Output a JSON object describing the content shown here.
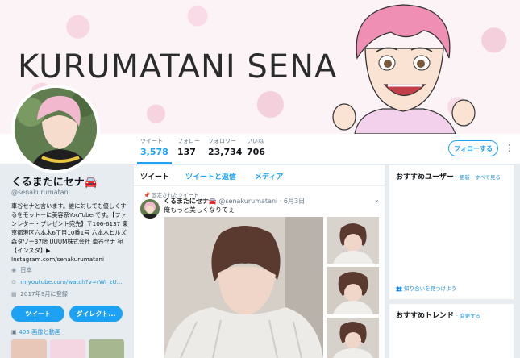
{
  "banner": {
    "title": "KURUMATANI SENA"
  },
  "nav": {
    "stats": [
      {
        "label": "ツイート",
        "value": "3,578"
      },
      {
        "label": "フォロー",
        "value": "137"
      },
      {
        "label": "フォロワー",
        "value": "23,734"
      },
      {
        "label": "いいね",
        "value": "706"
      }
    ],
    "follow_label": "フォローする",
    "more_glyph": "⋮"
  },
  "profile": {
    "name": "くるまたにセナ🚘",
    "handle": "@senakurumatani",
    "bio": "車谷セナと言います。誰に対しても優しくするをモットーに美容系YouTuberです。【ファンレター・プレゼント宛先】〒106-6137 東京都港区六本木6丁目10番1号 六本木ヒルズ森タワー37階 UUUM株式会社 車谷セナ 宛 【インスタ】▶ Instagram.com/senakurumatani",
    "location": "日本",
    "website": "m.youtube.com/watch?v=rWI_zU...",
    "joined": "2017年9月に登録",
    "tweet_button": "ツイート",
    "dm_button": "ダイレクト...",
    "media_link": "405 画像と動画"
  },
  "timeline": {
    "tabs": [
      "ツイート",
      "ツイートと返信",
      "メディア"
    ],
    "pinned_label": "固定されたツイート",
    "tweet": {
      "name": "くるまたにセナ🚘",
      "handle": "@senakurumatani",
      "date": "· 6月3日",
      "text": "俺もっと美しくなりてぇ"
    }
  },
  "sidebar": {
    "recommended_users": {
      "title": "おすすめユーザー",
      "links": "· 更新 · すべて見る"
    },
    "find_friends": "知り合いを見つけよう",
    "trends": {
      "title": "おすすめトレンド",
      "links": "· 変更する"
    }
  },
  "colors": {
    "accent": "#1da1f2",
    "hair_pink": "#f08fb4",
    "banner_bg": "#fbf3f6"
  }
}
